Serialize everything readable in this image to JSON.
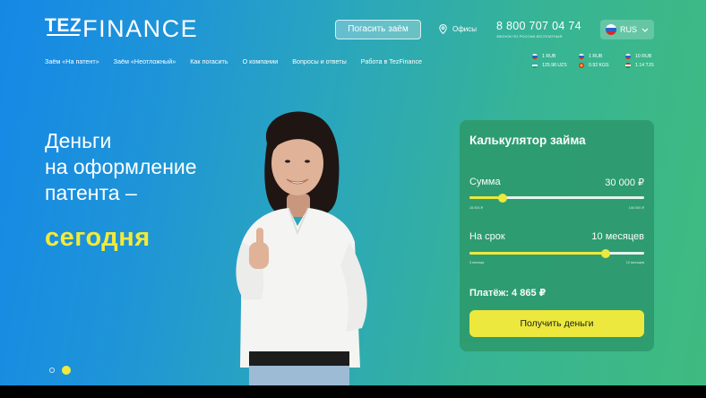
{
  "brand": {
    "logo_tez": "TEZ",
    "logo_finance": "FINANCE"
  },
  "header": {
    "repay_label": "Погасить заём",
    "offices_label": "Офисы",
    "phone": "8 800 707 04 74",
    "phone_note": "ЗВОНОК ПО РОССИИ БЕСПЛАТНЫЙ",
    "lang_code": "RUS"
  },
  "nav": [
    "Заём «На патент»",
    "Заём «Неотложный»",
    "Как погасить",
    "О компании",
    "Вопросы и ответы",
    "Работа в TezFinance"
  ],
  "rates": [
    {
      "text": "1 RUB",
      "flag": "ru"
    },
    {
      "text": "1 RUB",
      "flag": "ru"
    },
    {
      "text": "10 RUB",
      "flag": "ru"
    },
    {
      "text": "125.98 UZS",
      "flag": "uz"
    },
    {
      "text": "0.92 KGS",
      "flag": "kg"
    },
    {
      "text": "1.14 TJS",
      "flag": "tj"
    }
  ],
  "hero": {
    "lines": [
      "Деньги",
      "на оформление",
      "патента –"
    ],
    "accent": "сегодня"
  },
  "calculator": {
    "title": "Калькулятор займа",
    "amount_label": "Сумма",
    "amount_value": "30 000 ₽",
    "amount_min": "15 000 ₽",
    "amount_max": "100 000 ₽",
    "amount_fraction": 0.19,
    "term_label": "На срок",
    "term_value": "10 месяцев",
    "term_min": "3 месяца",
    "term_max": "12 месяцев",
    "term_fraction": 0.78,
    "payment": "Платёж: 4 865 ₽",
    "cta": "Получить деньги"
  },
  "colors": {
    "accent_yellow": "#f2ea3b",
    "calc_bg": "#2e9c70",
    "gradient_start": "#1588e6",
    "gradient_end": "#3fbb7f"
  }
}
